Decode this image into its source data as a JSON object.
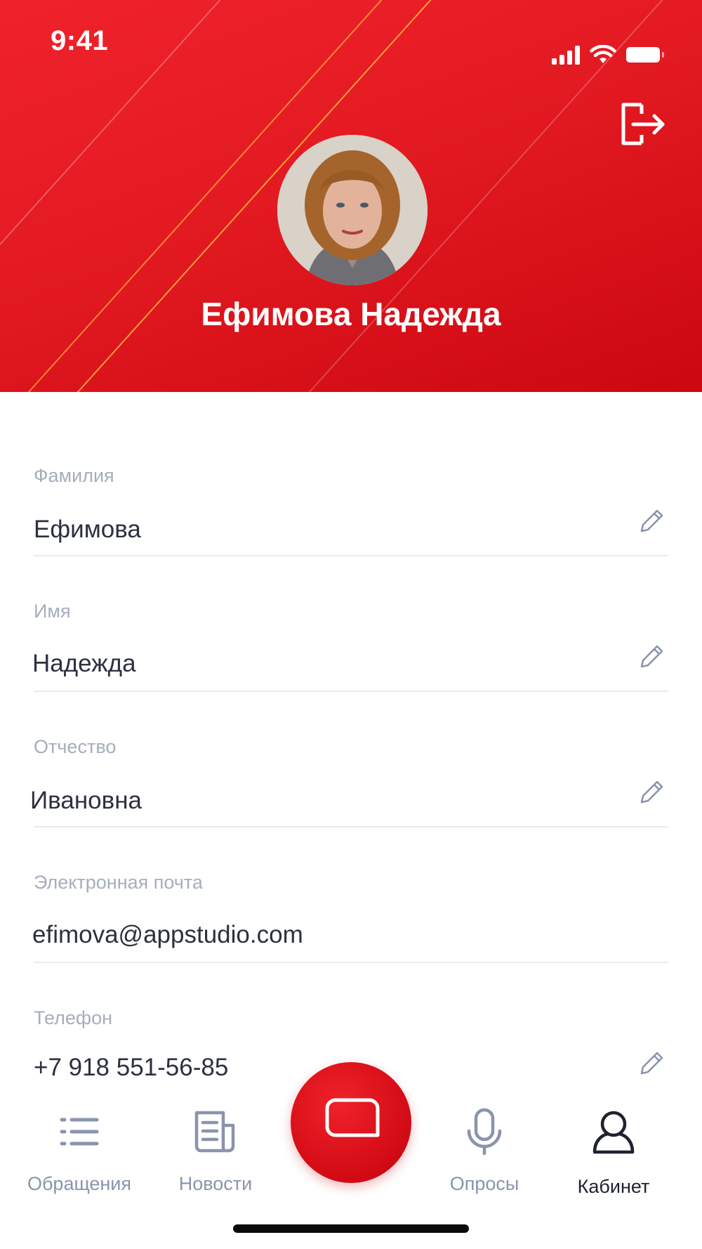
{
  "status_bar": {
    "time": "9:41"
  },
  "profile": {
    "name": "Ефимова Надежда"
  },
  "fields": {
    "surname": {
      "label": "Фамилия",
      "value": "Ефимова"
    },
    "first_name": {
      "label": "Имя",
      "value": "Надежда"
    },
    "patronymic": {
      "label": "Отчество",
      "value": "Ивановна"
    },
    "email": {
      "label": "Электронная почта",
      "value": "efimova@appstudio.com"
    },
    "phone": {
      "label": "Телефон",
      "value": "+7 918 551-56-85"
    }
  },
  "tabbar": {
    "tabs": [
      {
        "label": "Обращения",
        "icon": "list-icon"
      },
      {
        "label": "Новости",
        "icon": "news-icon"
      },
      {
        "label": "Опросы",
        "icon": "microphone-icon"
      },
      {
        "label": "Кабинет",
        "icon": "user-icon",
        "active": true
      }
    ],
    "center_icon": "chat-bubble-icon"
  },
  "colors": {
    "accent": "#e31a22",
    "label": "#a6adbd",
    "text": "#2c3040",
    "tab_inactive": "#8a94ad",
    "tab_active": "#1f2230"
  }
}
